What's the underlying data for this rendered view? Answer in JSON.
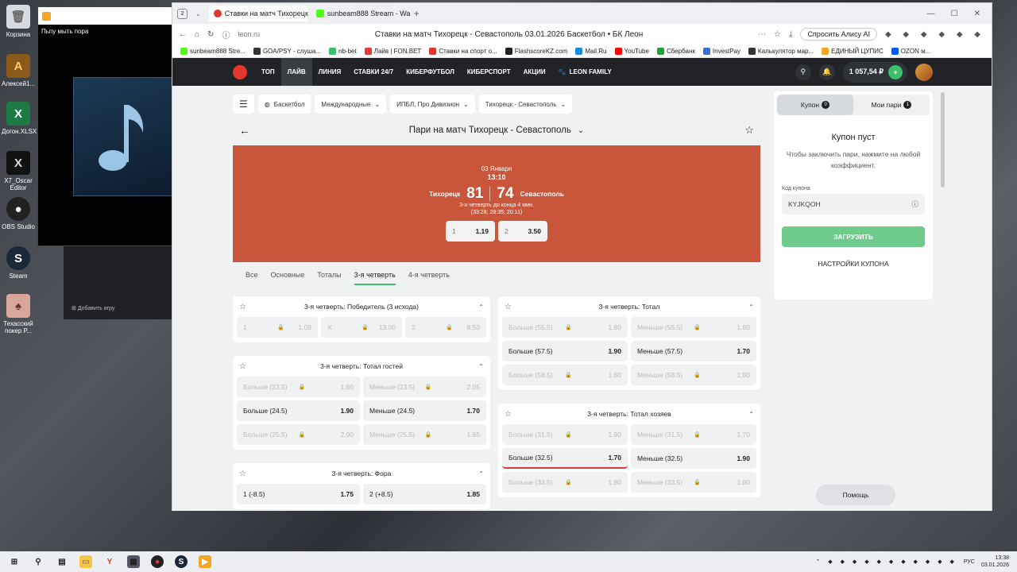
{
  "desktop": {
    "icons": [
      {
        "label": "Корзина"
      },
      {
        "label": "Алексей1..."
      },
      {
        "label": "Догон.XLSX"
      },
      {
        "label": "X7_Oscar Editor"
      },
      {
        "label": "OBS Studio"
      },
      {
        "label": "Steam"
      },
      {
        "label": "Техасский покер Р..."
      }
    ],
    "player_title": "Пьпу мыть пора",
    "steam_add_game": "Добавить игру"
  },
  "browser": {
    "tab_count": "2",
    "tabs": [
      {
        "label": "Ставки на матч Тихорецк",
        "favicon_color": "#e2362e"
      },
      {
        "label": "sunbeam888 Stream - Wa",
        "favicon_color": "#53fc18"
      }
    ],
    "new_tab": "+",
    "url": "leon.ru",
    "page_title": "Ставки на матч Тихорецк - Севастополь 03.01.2026 Баскетбол • БК Леон",
    "alice": "Спросить Алису AI",
    "bookmarks": [
      {
        "label": "sunbeam888 Stre...",
        "color": "#53fc18"
      },
      {
        "label": "GOA/PSY - слуша...",
        "color": "#333333"
      },
      {
        "label": "nb-bet",
        "color": "#3bbf6a"
      },
      {
        "label": "Лайв | FON.BET",
        "color": "#e53935"
      },
      {
        "label": "Ставки на спорт о...",
        "color": "#e2362e"
      },
      {
        "label": "FlashscoreKZ.com",
        "color": "#222222"
      },
      {
        "label": "Mail.Ru",
        "color": "#168de2"
      },
      {
        "label": "YouTube",
        "color": "#ff0000"
      },
      {
        "label": "Сбербанк",
        "color": "#21a038"
      },
      {
        "label": "InvestPay",
        "color": "#3b6fd8"
      },
      {
        "label": "Калькулятор мар...",
        "color": "#333333"
      },
      {
        "label": "ЕДИНЫЙ ЦУПИС",
        "color": "#f5a623"
      },
      {
        "label": "OZON м...",
        "color": "#005bff"
      }
    ]
  },
  "site": {
    "nav": [
      "ТОП",
      "ЛАЙВ",
      "ЛИНИЯ",
      "СТАВКИ 24/7",
      "КИБЕРФУТБОЛ",
      "КИБЕРСПОРТ",
      "АКЦИИ",
      "LEON FAMILY"
    ],
    "balance": "1 057,54 ₽",
    "breadcrumbs": [
      "Баскетбол",
      "Международные",
      "ИПБЛ, Про Дивизион",
      "Тихорецк - Севастополь"
    ],
    "match_header": "Пари на матч Тихорецк - Севастополь",
    "hero": {
      "date": "03 Января",
      "time": "13:10",
      "home": "Тихорецк",
      "away": "Севастополь",
      "home_score": "81",
      "away_score": "74",
      "period": "3-я четверть до конца 4 мин.",
      "quarters": "(33:28; 28:35; 20:11)",
      "odds": [
        {
          "label": "1",
          "value": "1.19"
        },
        {
          "label": "2",
          "value": "3.50"
        }
      ]
    },
    "market_tabs": [
      "Все",
      "Основные",
      "Тоталы",
      "3-я четверть",
      "4-я четверть"
    ],
    "markets_left": [
      {
        "title": "3-я четверть: Победитель (3 исхода)",
        "rows": [
          [
            {
              "l": "1",
              "v": "1.09",
              "lock": true
            },
            {
              "l": "X",
              "v": "13.00",
              "lock": true
            },
            {
              "l": "2",
              "v": "8.50",
              "lock": true
            }
          ]
        ]
      },
      {
        "title": "3-я четверть: Тотал гостей",
        "rows": [
          [
            {
              "l": "Больше (23.5)",
              "v": "1.60",
              "lock": true
            },
            {
              "l": "Меньше (23.5)",
              "v": "2.05",
              "lock": true
            }
          ],
          [
            {
              "l": "Больше (24.5)",
              "v": "1.90",
              "lock": false
            },
            {
              "l": "Меньше (24.5)",
              "v": "1.70",
              "lock": false
            }
          ],
          [
            {
              "l": "Больше (25.5)",
              "v": "2.00",
              "lock": true
            },
            {
              "l": "Меньше (25.5)",
              "v": "1.65",
              "lock": true
            }
          ]
        ]
      },
      {
        "title": "3-я четверть: Фора",
        "rows": [
          [
            {
              "l": "1 (-8.5)",
              "v": "1.75",
              "lock": false
            },
            {
              "l": "2 (+8.5)",
              "v": "1.85",
              "lock": false
            }
          ]
        ]
      }
    ],
    "markets_right": [
      {
        "title": "3-я четверть: Тотал",
        "rows": [
          [
            {
              "l": "Больше (55.5)",
              "v": "1.80",
              "lock": true
            },
            {
              "l": "Меньше (55.5)",
              "v": "1.80",
              "lock": true
            }
          ],
          [
            {
              "l": "Больше (57.5)",
              "v": "1.90",
              "lock": false
            },
            {
              "l": "Меньше (57.5)",
              "v": "1.70",
              "lock": false
            }
          ],
          [
            {
              "l": "Больше (58.5)",
              "v": "1.80",
              "lock": true
            },
            {
              "l": "Меньше (58.5)",
              "v": "1.80",
              "lock": true
            }
          ]
        ]
      },
      {
        "title": "3-я четверть: Тотал хозяев",
        "rows": [
          [
            {
              "l": "Больше (31.5)",
              "v": "1.90",
              "lock": true
            },
            {
              "l": "Меньше (31.5)",
              "v": "1.70",
              "lock": true
            }
          ],
          [
            {
              "l": "Больше (32.5)",
              "v": "1.70",
              "lock": false
            },
            {
              "l": "Меньше (32.5)",
              "v": "1.90",
              "lock": false
            }
          ],
          [
            {
              "l": "Больше (33.5)",
              "v": "1.80",
              "lock": true
            },
            {
              "l": "Меньше (33.5)",
              "v": "1.80",
              "lock": true
            }
          ]
        ]
      }
    ],
    "coupon": {
      "tab_coupon": "Купон",
      "tab_coupon_count": "0",
      "tab_my_bets": "Мои пари",
      "tab_my_bets_count": "1",
      "empty_title": "Купон пуст",
      "hint": "Чтобы заключить пари, нажмите на любой коэффициент.",
      "code_label": "Код купона",
      "code_value": "KYJKQOH",
      "load_button": "ЗАГРУЗИТЬ",
      "settings": "НАСТРОЙКИ КУПОНА"
    },
    "help": "Помощь"
  },
  "taskbar": {
    "lang": "РУС",
    "time": "13:38",
    "date": "03.01.2026"
  }
}
